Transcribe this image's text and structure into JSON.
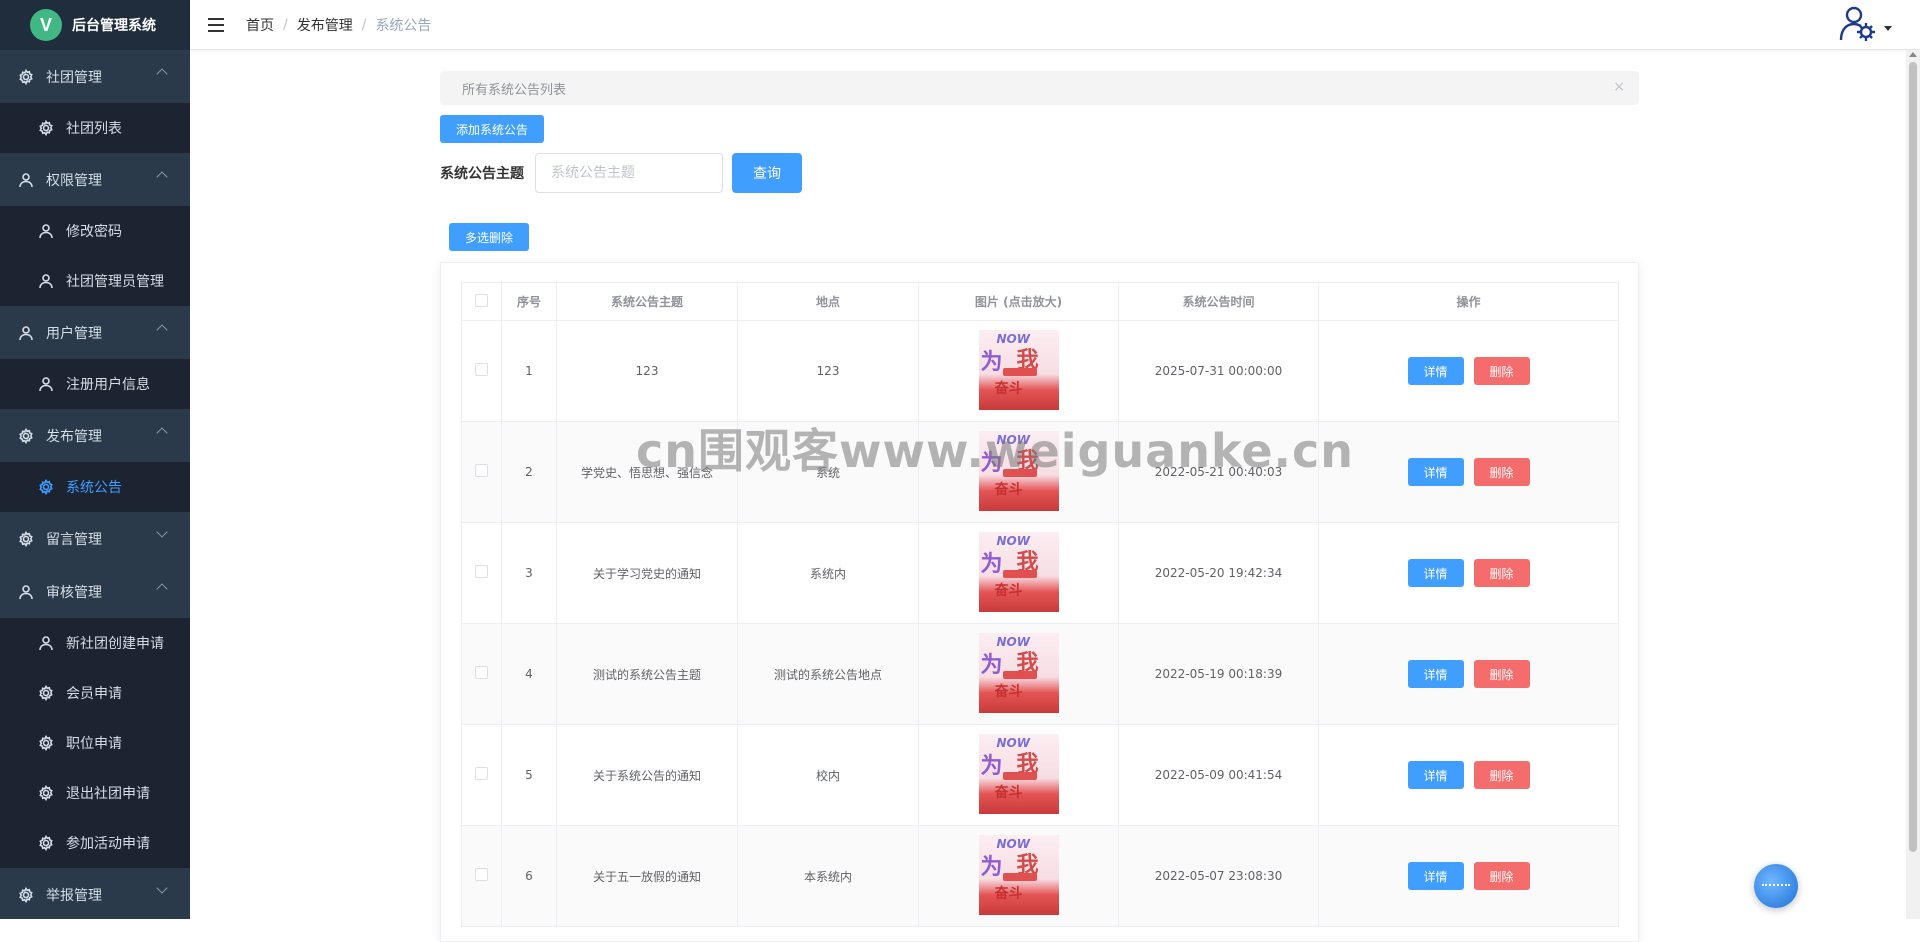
{
  "app": {
    "title": "后台管理系统",
    "logo_letter": "V"
  },
  "sidebar": {
    "groups": [
      {
        "label": "社团管理",
        "icon": "gear-icon",
        "expanded": true,
        "items": [
          {
            "label": "社团列表",
            "icon": "gear-icon"
          }
        ]
      },
      {
        "label": "权限管理",
        "icon": "user-icon",
        "expanded": true,
        "items": [
          {
            "label": "修改密码",
            "icon": "user-icon"
          },
          {
            "label": "社团管理员管理",
            "icon": "user-icon"
          }
        ]
      },
      {
        "label": "用户管理",
        "icon": "user-icon",
        "expanded": true,
        "items": [
          {
            "label": "注册用户信息",
            "icon": "user-icon"
          }
        ]
      },
      {
        "label": "发布管理",
        "icon": "gear-icon",
        "expanded": true,
        "items": [
          {
            "label": "系统公告",
            "icon": "gear-icon",
            "active": true
          }
        ]
      },
      {
        "label": "留言管理",
        "icon": "gear-icon",
        "expanded": false,
        "items": []
      },
      {
        "label": "审核管理",
        "icon": "user-icon",
        "expanded": true,
        "items": [
          {
            "label": "新社团创建申请",
            "icon": "user-icon"
          },
          {
            "label": "会员申请",
            "icon": "gear-icon"
          },
          {
            "label": "职位申请",
            "icon": "gear-icon"
          },
          {
            "label": "退出社团申请",
            "icon": "gear-icon"
          },
          {
            "label": "参加活动申请",
            "icon": "gear-icon"
          }
        ]
      },
      {
        "label": "举报管理",
        "icon": "gear-icon",
        "expanded": false,
        "items": []
      }
    ]
  },
  "breadcrumb": [
    "首页",
    "发布管理",
    "系统公告"
  ],
  "alert": {
    "text": "所有系统公告列表",
    "close": "×"
  },
  "toolbar": {
    "add_label": "添加系统公告",
    "search_label": "系统公告主题",
    "search_placeholder": "系统公告主题",
    "search_value": "",
    "query_label": "查询",
    "multi_delete_label": "多选删除"
  },
  "table": {
    "columns": [
      "序号",
      "系统公告主题",
      "地点",
      "图片 (点击放大)",
      "系统公告时间",
      "操作"
    ],
    "detail_label": "详情",
    "delete_label": "删除",
    "rows": [
      {
        "index": "1",
        "topic": "123",
        "place": "123",
        "time": "2025-07-31 00:00:00"
      },
      {
        "index": "2",
        "topic": "学党史、悟思想、强信念",
        "place": "系统",
        "time": "2022-05-21 00:40:03"
      },
      {
        "index": "3",
        "topic": "关于学习党史的通知",
        "place": "系统内",
        "time": "2022-05-20 19:42:34"
      },
      {
        "index": "4",
        "topic": "测试的系统公告主题",
        "place": "测试的系统公告地点",
        "time": "2022-05-19 00:18:39"
      },
      {
        "index": "5",
        "topic": "关于系统公告的通知",
        "place": "校内",
        "time": "2022-05-09 00:41:54"
      },
      {
        "index": "6",
        "topic": "关于五一放假的通知",
        "place": "本系统内",
        "time": "2022-05-07 23:08:30"
      }
    ],
    "image": {
      "now_text": "NOW"
    }
  },
  "watermark": "cn围观客www.weiguanke.cn",
  "colors": {
    "sidebar_bg": "#1e2a38",
    "primary": "#409eff",
    "danger": "#f56c6c",
    "active_menu": "#409eff"
  }
}
